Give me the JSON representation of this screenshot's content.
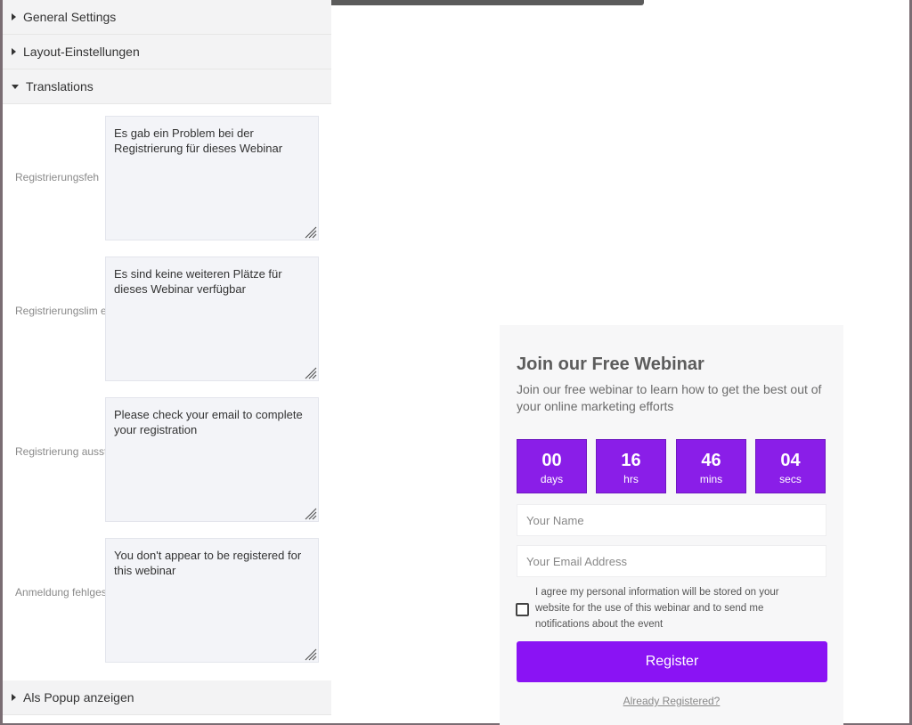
{
  "sidebar": {
    "sections": [
      {
        "label": "General Settings",
        "state": "collapsed"
      },
      {
        "label": "Layout-Einstellungen",
        "state": "collapsed"
      },
      {
        "label": "Translations",
        "state": "expanded"
      },
      {
        "label": "Als Popup anzeigen",
        "state": "collapsed"
      }
    ],
    "fields": [
      {
        "label": "Registrierungsfeh",
        "value": "Es gab ein Problem bei der Registrierung für dieses Webinar"
      },
      {
        "label": "Registrierungslim erreicht",
        "value": "Es sind keine weiteren Plätze für dieses Webinar verfügbar"
      },
      {
        "label": "Registrierung ausstehend",
        "value": "Please check your email to complete your registration"
      },
      {
        "label": "Anmeldung fehlgeschlagen",
        "value": "You don't appear to be registered for this webinar"
      }
    ]
  },
  "widget": {
    "title": "Join our Free Webinar",
    "description": "Join our free webinar to learn how to get the best out of your online marketing efforts",
    "countdown": [
      {
        "value": "00",
        "unit": "days"
      },
      {
        "value": "16",
        "unit": "hrs"
      },
      {
        "value": "46",
        "unit": "mins"
      },
      {
        "value": "04",
        "unit": "secs"
      }
    ],
    "name_placeholder": "Your Name",
    "email_placeholder": "Your Email Address",
    "consent_text": "I agree my personal information will be stored on your website for the use of this webinar and to send me notifications about the event",
    "register_label": "Register",
    "already_registered_label": "Already Registered?"
  },
  "colors": {
    "accent": "#8a13f4",
    "countdown_bg": "#8a1ee8"
  }
}
